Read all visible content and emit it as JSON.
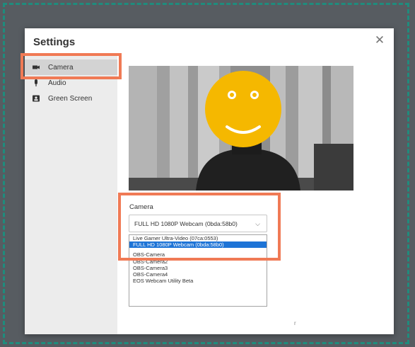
{
  "dialog": {
    "title": "Settings"
  },
  "sidebar": {
    "items": [
      {
        "label": "Camera",
        "icon": "camera-icon",
        "active": true
      },
      {
        "label": "Audio",
        "icon": "microphone-icon",
        "active": false
      },
      {
        "label": "Green Screen",
        "icon": "green-screen-icon",
        "active": false
      }
    ]
  },
  "camera": {
    "label": "Camera",
    "selected": "FULL HD 1080P Webcam (0bda:58b0)",
    "options": [
      "Live Gamer Ultra-Video (07ca:0553)",
      "FULL HD 1080P Webcam (0bda:58b0)",
      "OBS-Camera",
      "OBS-Camera2",
      "OBS-Camera3",
      "OBS-Camera4",
      "EOS Webcam Utility Beta"
    ],
    "partial_text": "r"
  },
  "colors": {
    "highlight": "#f07a55",
    "selected_option": "#1e74d6",
    "background": "#575c61",
    "dashed_border": "#1f8c7d",
    "emoji": "#f5b800"
  }
}
